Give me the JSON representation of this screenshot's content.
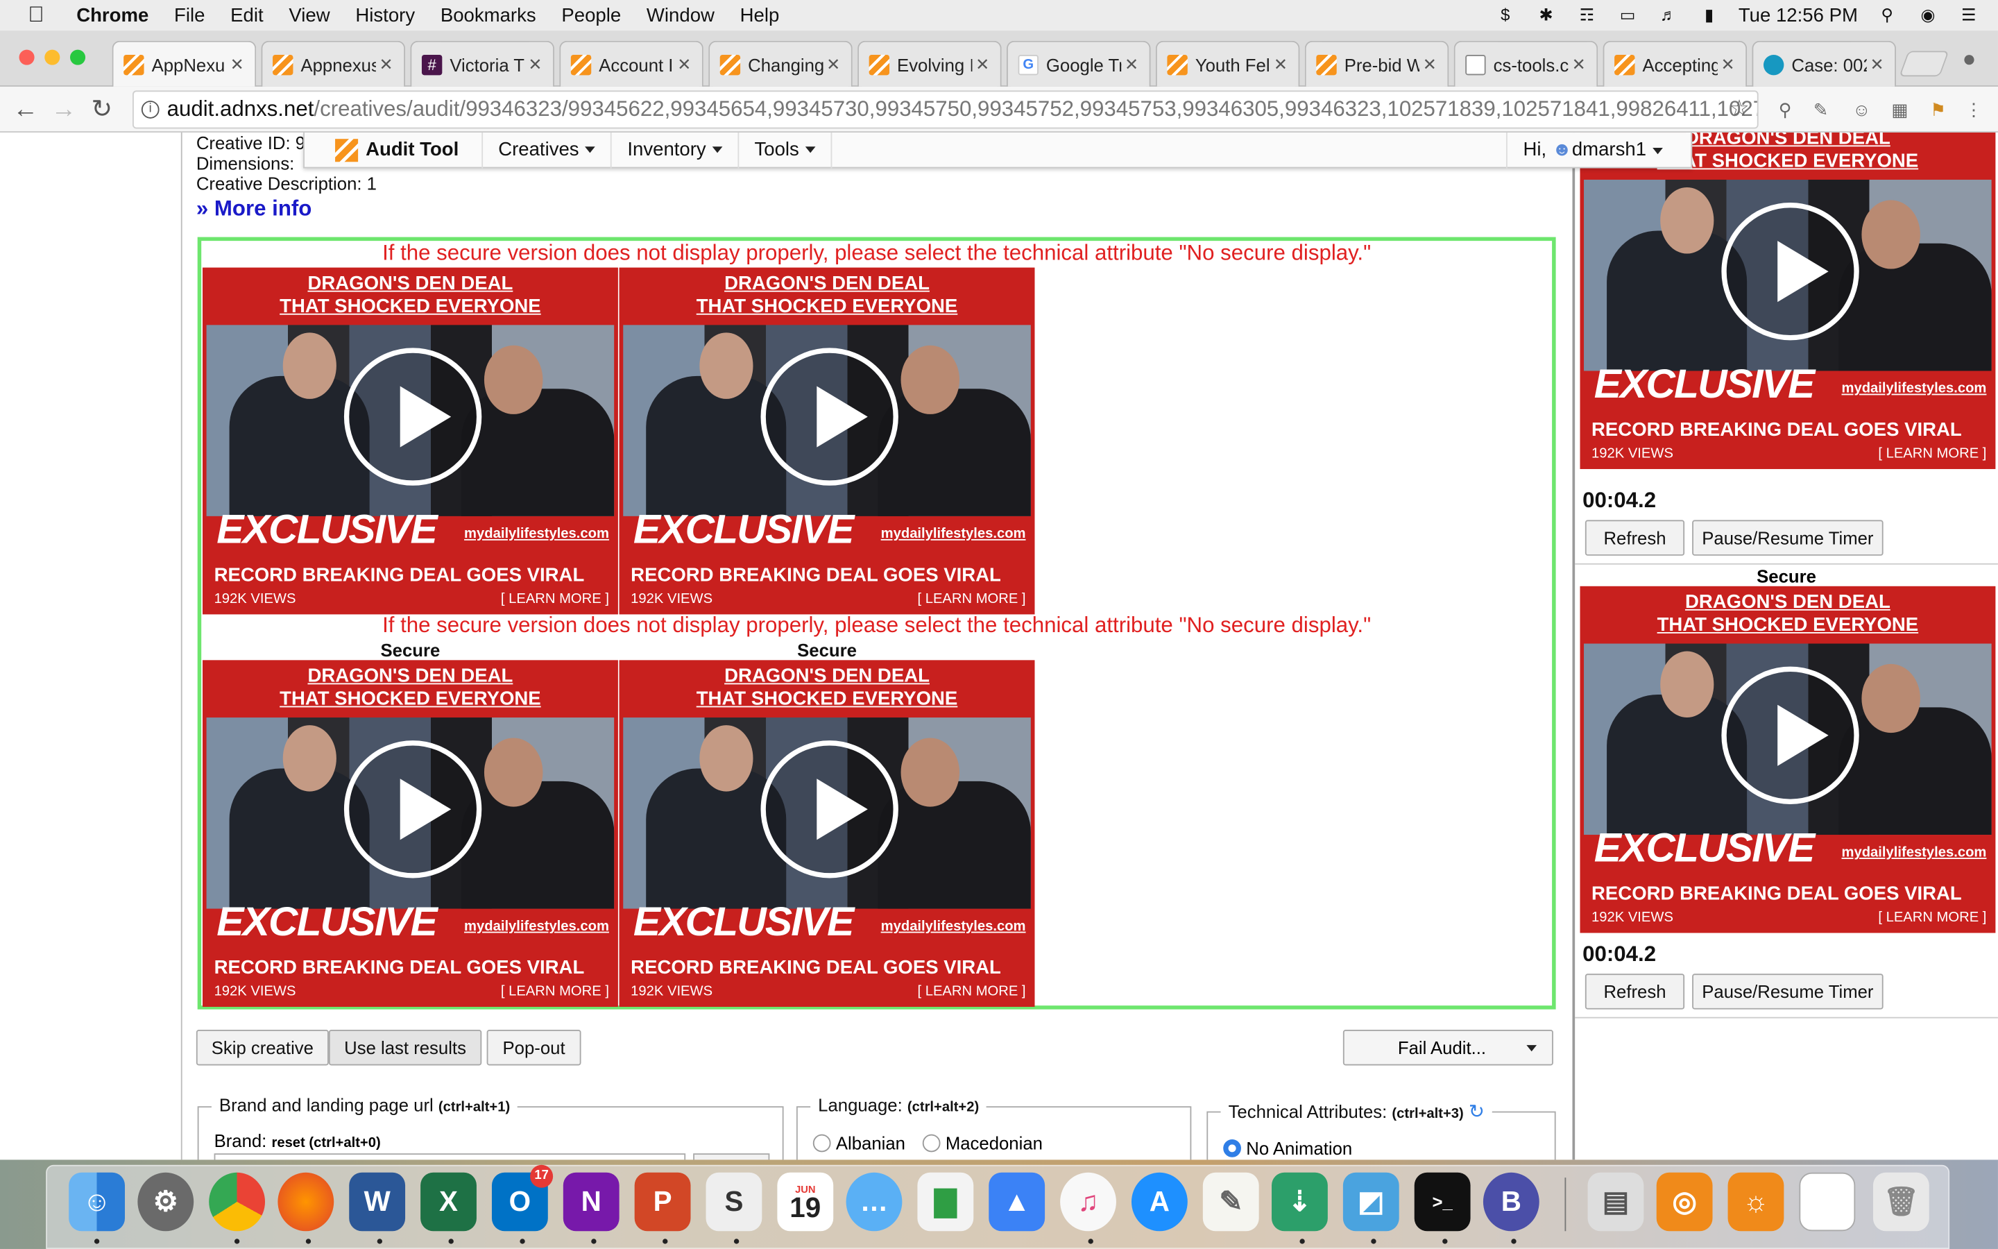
{
  "menubar": {
    "app": "Chrome",
    "items": [
      "File",
      "Edit",
      "View",
      "History",
      "Bookmarks",
      "People",
      "Window",
      "Help"
    ],
    "clock": "Tue 12:56 PM"
  },
  "tabs": [
    {
      "title": "AppNexu",
      "icon": "appnexus-icon",
      "active": true
    },
    {
      "title": "Appnexus",
      "icon": "appnexus-icon"
    },
    {
      "title": "Victoria T",
      "icon": "slack-icon"
    },
    {
      "title": "Account I",
      "icon": "appnexus-icon"
    },
    {
      "title": "Changing",
      "icon": "appnexus-icon"
    },
    {
      "title": "Evolving I",
      "icon": "appnexus-icon"
    },
    {
      "title": "Google Tr",
      "icon": "google-icon"
    },
    {
      "title": "Youth Fel",
      "icon": "appnexus-icon"
    },
    {
      "title": "Pre-bid W",
      "icon": "appnexus-icon"
    },
    {
      "title": "cs-tools.c",
      "icon": "document-icon"
    },
    {
      "title": "Accepting",
      "icon": "appnexus-icon"
    },
    {
      "title": "Case: 002",
      "icon": "salesforce-icon"
    }
  ],
  "address": {
    "host": "audit.adnxs.net",
    "path": "/creatives/audit/99346323/99345622,99345654,99345730,99345750,99345752,99345753,99346305,99346323,102571839,102571841,99826411,1027..."
  },
  "toolnav": {
    "brand": "Audit Tool",
    "items": [
      "Creatives",
      "Inventory",
      "Tools"
    ],
    "greeting": "Hi,",
    "username": "dmarsh1"
  },
  "meta": {
    "creative_id_label": "Creative ID: 9",
    "dimensions_label": "Dimensions: ",
    "description": "Creative Description: 1",
    "more_info": "» More info"
  },
  "preview": {
    "notice": "If the secure version does not display properly, please select the technical attribute \"No secure display.\"",
    "secure_label": "Secure"
  },
  "ad": {
    "headline1": "DRAGON'S DEN DEAL",
    "headline2": "THAT SHOCKED EVERYONE",
    "exclusive": "EXCLUSIVE",
    "site": "mydailylifestyles.com",
    "deal": "RECORD BREAKING DEAL GOES VIRAL",
    "views": "192K VIEWS",
    "learn": "[ LEARN MORE ]"
  },
  "actions": {
    "skip": "Skip creative",
    "last": "Use last results",
    "popout": "Pop-out",
    "fail": "Fail Audit..."
  },
  "brand_group": {
    "legend": "Brand and landing page url",
    "shortcut": "(ctrl+alt+1)",
    "brand_label": "Brand:",
    "reset": "reset (ctrl+alt+0)"
  },
  "language_group": {
    "legend": "Language:",
    "shortcut": "(ctrl+alt+2)",
    "options": [
      "Albanian",
      "Macedonian"
    ]
  },
  "tech_group": {
    "legend": "Technical Attributes:",
    "shortcut": "(ctrl+alt+3)",
    "option": "No Animation"
  },
  "side": {
    "timer": "00:04.2",
    "refresh": "Refresh",
    "pause": "Pause/Resume Timer",
    "secure_label": "Secure"
  },
  "dock": {
    "calendar_month": "JUN",
    "calendar_day": "19",
    "outlook_badge": "17"
  }
}
